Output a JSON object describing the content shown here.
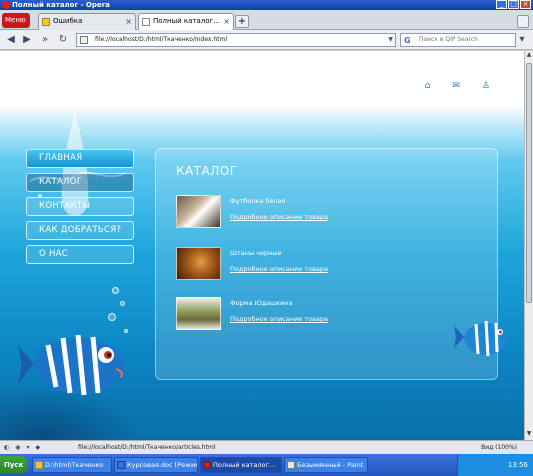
{
  "window": {
    "title": "Полный каталог - Opera",
    "controls": [
      "_",
      "□",
      "×"
    ]
  },
  "browser": {
    "menu_label": "Меню",
    "tabs": [
      {
        "label": "Ошибка"
      },
      {
        "label": "Полный каталог..."
      }
    ],
    "new_tab_label": "+",
    "address": "file://localhost/D:/html/Ткаченко/Index.html",
    "search_placeholder": "Поиск в QIP Search",
    "search_engine_letter": "G"
  },
  "page": {
    "top_icons": [
      "home-icon",
      "mail-icon",
      "sitemap-icon"
    ],
    "nav": [
      {
        "label": "ГЛАВНАЯ",
        "state": "highlight"
      },
      {
        "label": "КАТАЛОГ",
        "state": "current"
      },
      {
        "label": "КОНТАКТЫ",
        "state": "normal"
      },
      {
        "label": "КАК ДОБРАТЬСЯ?",
        "state": "normal"
      },
      {
        "label": "О НАС",
        "state": "normal"
      }
    ],
    "catalog": {
      "title": "КАТАЛОГ",
      "items": [
        {
          "name": "Футболка белая",
          "link": "Подробное описание товара"
        },
        {
          "name": "Штаны черные",
          "link": "Подробное описание товара"
        },
        {
          "name": "Форма Юдашкина",
          "link": "Подробное описание товара"
        }
      ]
    }
  },
  "statusbar": {
    "url": "file://localhost/D:/html/Ткаченко/articles.html",
    "zoom": "Вид (100%)"
  },
  "taskbar": {
    "start_label": "Пуск",
    "tasks": [
      {
        "label": "D:\\html\\Ткаченко"
      },
      {
        "label": "Курсовая.doc [Режим о..."
      },
      {
        "label": "Полный каталог..."
      },
      {
        "label": "Безымянный - Paint"
      }
    ],
    "clock": "13:56"
  }
}
